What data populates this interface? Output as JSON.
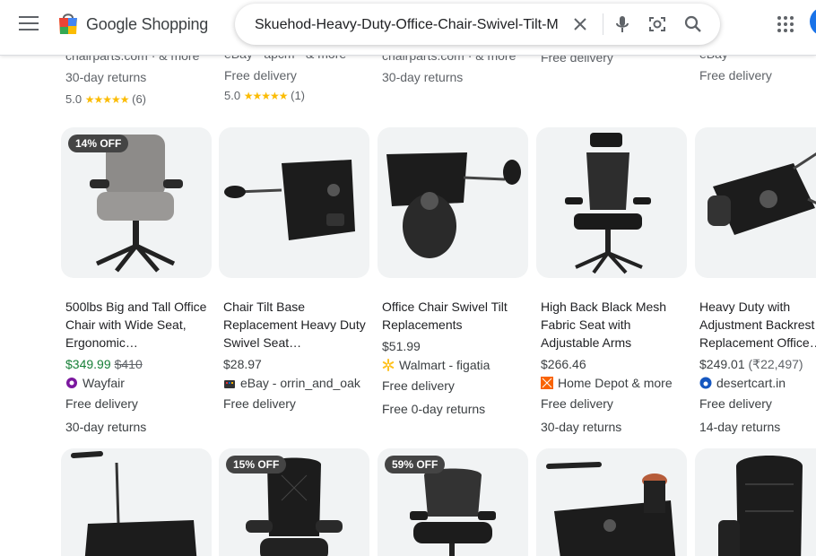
{
  "app": {
    "logo_text": "Google Shopping"
  },
  "search": {
    "query": "Skuehod-Heavy-Duty-Office-Chair-Swivel-Tilt-M"
  },
  "top_row": [
    {
      "line1": "chairparts.com · & more",
      "line2": "30-day returns",
      "rating": "5.0",
      "reviews": "(6)"
    },
    {
      "line1": "eBay · apcm · & more",
      "line2": "Free delivery",
      "rating": "5.0",
      "reviews": "(1)"
    },
    {
      "line1": "chairparts.com · & more",
      "line2": "30-day returns"
    },
    {
      "line1": "Free delivery"
    },
    {
      "line1": "eBay",
      "line2": "Free delivery"
    }
  ],
  "products": [
    {
      "badge": "14% OFF",
      "title": "500lbs Big and Tall Office Chair with Wide Seat, Ergonomic…",
      "price": "$349.99",
      "old_price": "$410",
      "store": "Wayfair",
      "line1": "Free delivery",
      "line2": "30-day returns"
    },
    {
      "title": "Chair Tilt Base Replacement Heavy Duty Swivel Seat…",
      "price": "$28.97",
      "store": "eBay - orrin_and_oak",
      "line1": "Free delivery"
    },
    {
      "title": "Office Chair Swivel Tilt Replacements",
      "price": "$51.99",
      "store": "Walmart - figatia",
      "line1": "Free delivery",
      "line2": "Free 0-day returns"
    },
    {
      "title": "High Back Black Mesh Fabric Seat with Adjustable Arms",
      "price": "$266.46",
      "store": "Home Depot & more",
      "line1": "Free delivery",
      "line2": "30-day returns"
    },
    {
      "title": "Heavy Duty with Adjustment Backrest Replacement Office…",
      "price": "$249.01",
      "alt_price": "(₹22,497)",
      "store": "desertcart.in",
      "line1": "Free delivery",
      "line2": "14-day returns"
    }
  ],
  "row3_badges": [
    "15% OFF",
    "59% OFF"
  ]
}
